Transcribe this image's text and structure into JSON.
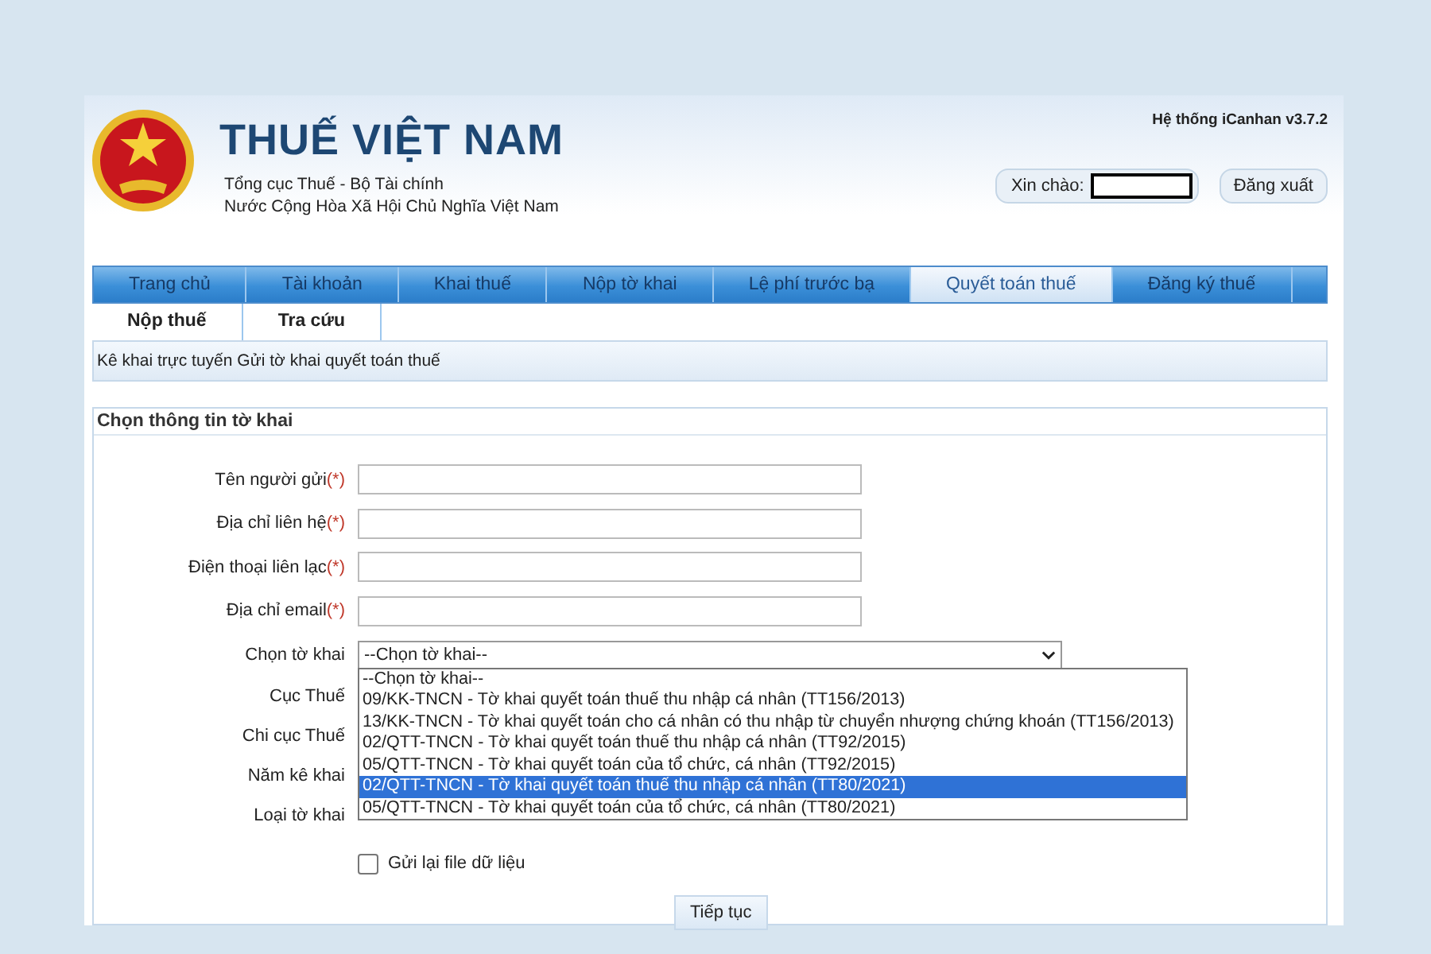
{
  "header": {
    "title": "THUẾ VIỆT NAM",
    "subtitle_lines": [
      "Tổng cục Thuế - Bộ Tài chính",
      "Nước Cộng Hòa Xã Hội Chủ Nghĩa Việt Nam"
    ],
    "system_version": "Hệ thống iCanhan v3.7.2",
    "greeting": "Xin chào:",
    "logout": "Đăng xuất"
  },
  "tabs": [
    {
      "label": "Trang chủ",
      "selected": false
    },
    {
      "label": "Tài khoản",
      "selected": false
    },
    {
      "label": "Khai thuế",
      "selected": false
    },
    {
      "label": "Nộp tờ khai",
      "selected": false
    },
    {
      "label": "Lệ phí trước bạ",
      "selected": false
    },
    {
      "label": "Quyết toán thuế",
      "selected": true
    },
    {
      "label": "Đăng ký thuế",
      "selected": false
    }
  ],
  "subtabs": [
    {
      "label": "Nộp thuế"
    },
    {
      "label": "Tra cứu"
    }
  ],
  "breadcrumb": "Kê khai trực tuyến  Gửi tờ khai quyết toán thuế",
  "form": {
    "title": "Chọn thông tin tờ khai",
    "rows": [
      {
        "kind": "text",
        "label": "Tên người gửi",
        "required": "(*)"
      },
      {
        "kind": "text",
        "label": "Địa chỉ liên hệ",
        "required": "(*)"
      },
      {
        "kind": "text",
        "label": "Điện thoại liên lạc",
        "required": "(*)"
      },
      {
        "kind": "text",
        "label": "Địa chỉ email",
        "required": "(*)"
      },
      {
        "kind": "select",
        "label": "Chọn tờ khai",
        "value": "--Chọn tờ khai--",
        "options": [
          {
            "label": "--Chọn tờ khai--",
            "highlighted": false
          },
          {
            "label": "09/KK-TNCN - Tờ khai quyết toán thuế thu nhập cá nhân (TT156/2013)",
            "highlighted": false
          },
          {
            "label": "13/KK-TNCN - Tờ khai quyết toán cho cá nhân có thu nhập từ chuyển nhượng chứng khoán (TT156/2013)",
            "highlighted": false
          },
          {
            "label": "02/QTT-TNCN - Tờ khai quyết toán thuế thu nhập cá nhân (TT92/2015)",
            "highlighted": false
          },
          {
            "label": "05/QTT-TNCN - Tờ khai quyết toán của tổ chức, cá nhân (TT92/2015)",
            "highlighted": false
          },
          {
            "label": "02/QTT-TNCN - Tờ khai quyết toán thuế thu nhập cá nhân (TT80/2021)",
            "highlighted": true
          },
          {
            "label": "05/QTT-TNCN - Tờ khai quyết toán của tổ chức, cá nhân (TT80/2021)",
            "highlighted": false
          }
        ]
      },
      {
        "kind": "covered",
        "label": "Cục Thuế"
      },
      {
        "kind": "covered",
        "label": "Chi cục Thuế"
      },
      {
        "kind": "covered",
        "label": "Năm kê khai"
      },
      {
        "kind": "covered",
        "label": "Loại tờ khai"
      }
    ],
    "resend": {
      "label": "Gửi lại file dữ liệu",
      "checked": false
    },
    "submit": "Tiếp tục"
  }
}
